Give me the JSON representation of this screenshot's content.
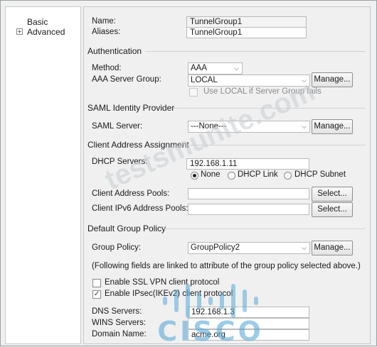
{
  "nav": {
    "items": [
      {
        "label": "Basic"
      },
      {
        "label": "Advanced"
      }
    ]
  },
  "basic": {
    "name_label": "Name:",
    "name_value": "TunnelGroup1",
    "aliases_label": "Aliases:",
    "aliases_value": "TunnelGroup1"
  },
  "authentication": {
    "title": "Authentication",
    "method_label": "Method:",
    "method_value": "AAA",
    "server_group_label": "AAA Server Group:",
    "server_group_value": "LOCAL",
    "manage_label": "Manage...",
    "use_local_label": "Use LOCAL if Server Group fails"
  },
  "saml": {
    "title": "SAML Identity Provider",
    "server_label": "SAML Server:",
    "server_value": "---None---",
    "manage_label": "Manage..."
  },
  "client_address": {
    "title": "Client Address Assignment",
    "dhcp_label": "DHCP Servers:",
    "dhcp_value": "192.168.1.11",
    "radio_none": "None",
    "radio_dhcp_link": "DHCP Link",
    "radio_dhcp_subnet": "DHCP Subnet",
    "pools_label": "Client Address Pools:",
    "pools_value": "",
    "ipv6_pools_label": "Client IPv6 Address Pools:",
    "ipv6_pools_value": "",
    "select_label": "Select..."
  },
  "group_policy": {
    "title": "Default Group Policy",
    "policy_label": "Group Policy:",
    "policy_value": "GroupPolicy2",
    "manage_label": "Manage...",
    "note": "(Following fields are linked to attribute of the group policy selected above.)",
    "ssl_vpn_label": "Enable SSL VPN client protocol",
    "ipsec_label": "Enable IPsec(IKEv2) client protocol",
    "dns_label": "DNS Servers:",
    "dns_value": "192.168.1.3",
    "wins_label": "WINS Servers:",
    "wins_value": "",
    "domain_label": "Domain Name:",
    "domain_value": "acme.org"
  },
  "watermark": {
    "text": "testsmunite.com",
    "logo_text": "CISCO"
  }
}
